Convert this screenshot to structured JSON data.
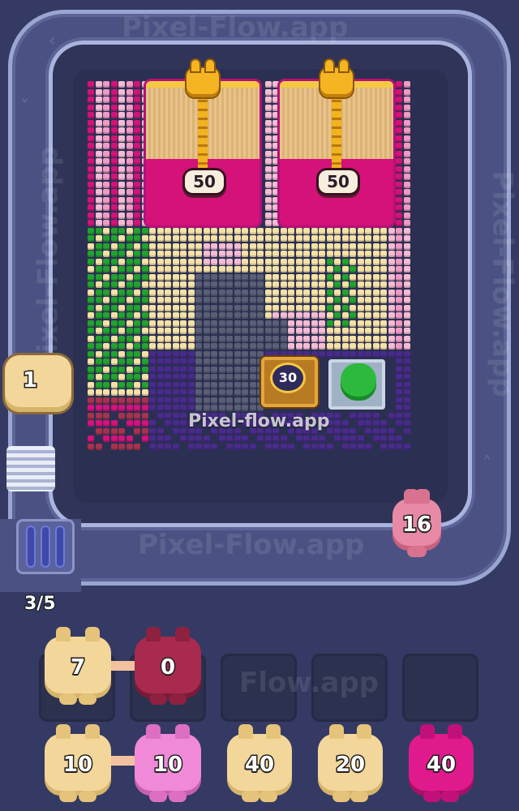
{
  "watermarks": {
    "top": "Pixel-Flow.app",
    "center": "Pixel-flow.app",
    "bottom_track": "Pixel-Flow.app",
    "right": "Pixel-Flow.app",
    "left": "Pixel-Flow.app",
    "slots": "Flow.app"
  },
  "locked_boxes": [
    {
      "value": "50"
    },
    {
      "value": "50"
    }
  ],
  "chest": {
    "value": "30"
  },
  "track_pigs": [
    {
      "value": "1",
      "color": "#f3d79a"
    },
    {
      "value": "16",
      "color": "#e88aa6"
    }
  ],
  "queue_counter": "3/5",
  "slot_pigs": [
    {
      "value": "7",
      "color": "#f3d79a"
    },
    {
      "value": "0",
      "color": "#a82a4e"
    }
  ],
  "bottom_pigs": [
    {
      "value": "10",
      "color": "#f3d79a"
    },
    {
      "value": "10",
      "color": "#f08ad8"
    },
    {
      "value": "40",
      "color": "#f3d79a"
    },
    {
      "value": "20",
      "color": "#f3d79a"
    },
    {
      "value": "40",
      "color": "#e01a8c"
    }
  ],
  "palette": {
    "magenta": "#d4127a",
    "pink": "#f29ac4",
    "light_pink": "#f6bcd4",
    "cream": "#f6e1a6",
    "green": "#22a32f",
    "gray": "#5a5f77",
    "purple": "#4a2a8c",
    "wine": "#a8324e"
  }
}
